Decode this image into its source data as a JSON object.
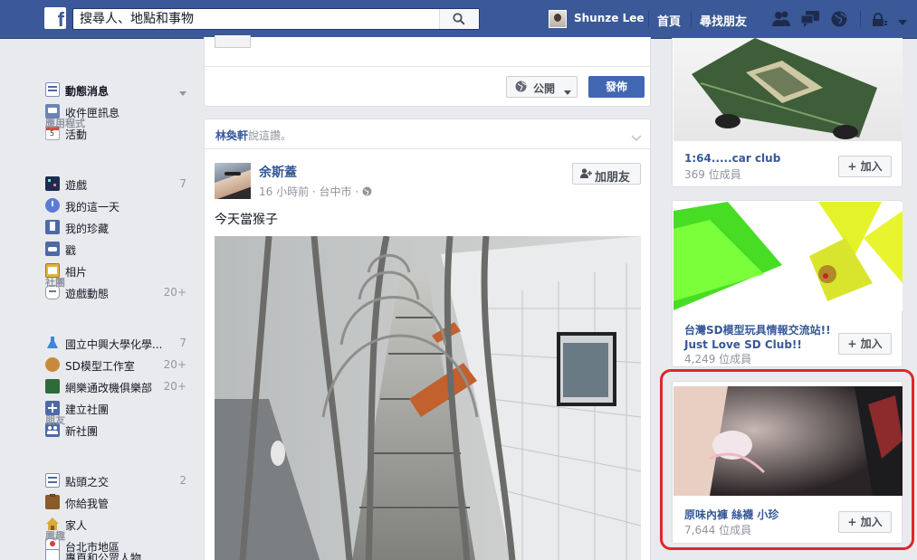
{
  "header": {
    "logo": "f",
    "search_placeholder": "搜尋人、地點和事物",
    "profile_name": "Shunze Lee",
    "home_label": "首頁",
    "find_friends_label": "尋找朋友"
  },
  "sidebar": {
    "favorites": [
      {
        "label": "動態消息",
        "bold": true
      },
      {
        "label": "收件匣訊息"
      },
      {
        "label": "活動"
      }
    ],
    "apps_heading": "應用程式",
    "apps": [
      {
        "label": "遊戲",
        "count": "7"
      },
      {
        "label": "我的這一天"
      },
      {
        "label": "我的珍藏"
      },
      {
        "label": "戳"
      },
      {
        "label": "相片"
      },
      {
        "label": "遊戲動態",
        "count": "20+"
      }
    ],
    "groups_heading": "社團",
    "groups": [
      {
        "label": "國立中興大學化學...",
        "count": "7"
      },
      {
        "label": "SD模型工作室",
        "count": "20+"
      },
      {
        "label": "網樂通改機俱樂部",
        "count": "20+"
      },
      {
        "label": "建立社團"
      },
      {
        "label": "新社團"
      }
    ],
    "friends_heading": "朋友",
    "friends": [
      {
        "label": "點頭之交",
        "count": "2"
      },
      {
        "label": "你給我管"
      },
      {
        "label": "家人"
      },
      {
        "label": "台北市地區"
      }
    ],
    "interests_heading": "興趣",
    "interests": [
      {
        "label": "專頁和公眾人物"
      }
    ]
  },
  "composer": {
    "privacy_label": "公開",
    "post_button": "發佈"
  },
  "post": {
    "story_actor": "林奐軒",
    "story_suffix": "說這讚。",
    "author": "余斯蓋",
    "add_friend": "加朋友",
    "meta": "16 小時前 · 台中市 · ",
    "text": "今天當猴子"
  },
  "groups": [
    {
      "name": "1:64.....car club",
      "members": "369 位成員",
      "join": "加入"
    },
    {
      "name": "台灣SD模型玩具情報交流站!! Just Love SD Club!!",
      "members": "4,249 位成員",
      "join": "加入"
    },
    {
      "name": "原味內褲 絲襪 小珍",
      "members": "7,644 位成員",
      "join": "加入"
    }
  ],
  "colors": {
    "brand": "#3b5998",
    "link": "#365899",
    "highlight": "#e2252a"
  }
}
